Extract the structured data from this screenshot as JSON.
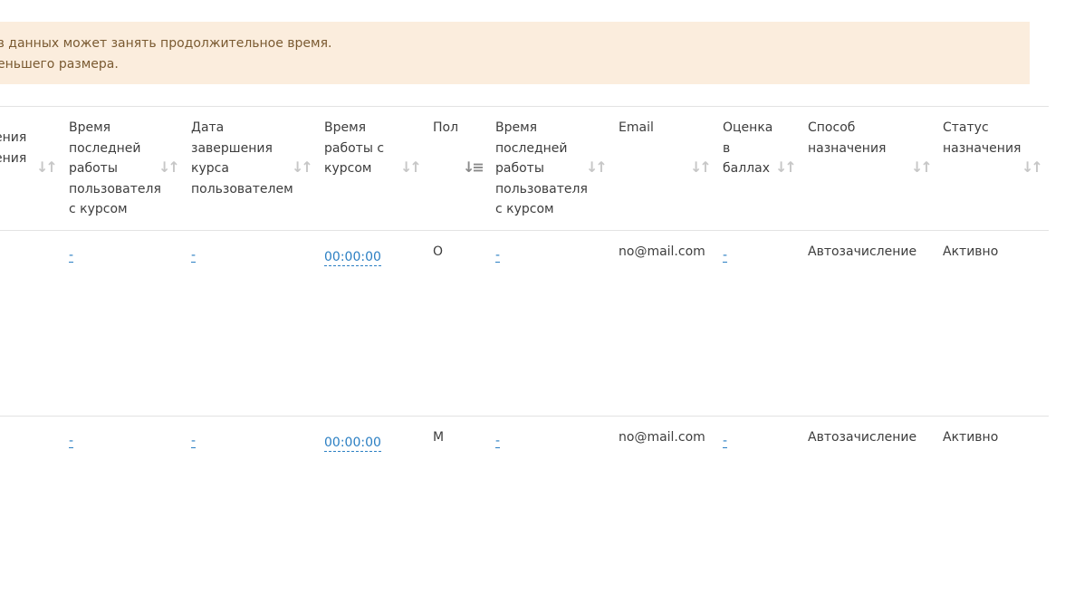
{
  "alert": {
    "line1": "ов данных может занять продолжительное время.",
    "line2": "еньшего размера."
  },
  "table": {
    "columns": [
      {
        "key": "partial",
        "label": "ения\nения\n:"
      },
      {
        "key": "last_work_1",
        "label": "Время\nпоследней\nработы\nпользователя\nс курсом"
      },
      {
        "key": "finish_date",
        "label": "Дата\nзавершения\nкурса\nпользователем"
      },
      {
        "key": "work_time",
        "label": "Время\nработы с\nкурсом"
      },
      {
        "key": "gender",
        "label": "Пол"
      },
      {
        "key": "last_work_2",
        "label": "Время\nпоследней\nработы\nпользователя\nс курсом"
      },
      {
        "key": "email",
        "label": "Email"
      },
      {
        "key": "score",
        "label": "Оценка\nв\nбаллах"
      },
      {
        "key": "method",
        "label": "Способ\nназначения"
      },
      {
        "key": "status",
        "label": "Статус\nназначения"
      }
    ],
    "rows": [
      {
        "last_work_1": "-",
        "finish_date": "-",
        "work_time": "00:00:00",
        "gender": "О",
        "last_work_2": "-",
        "email": "no@mail.com",
        "score": "-",
        "method": "Автозачисление",
        "status": "Активно"
      },
      {
        "last_work_1": "-",
        "finish_date": "-",
        "work_time": "00:00:00",
        "gender": "М",
        "last_work_2": "-",
        "email": "no@mail.com",
        "score": "-",
        "method": "Автозачисление",
        "status": "Активно"
      }
    ]
  },
  "icons": {
    "sort": "sort-arrows-icon",
    "sort_active": "sort-descending-icon"
  }
}
